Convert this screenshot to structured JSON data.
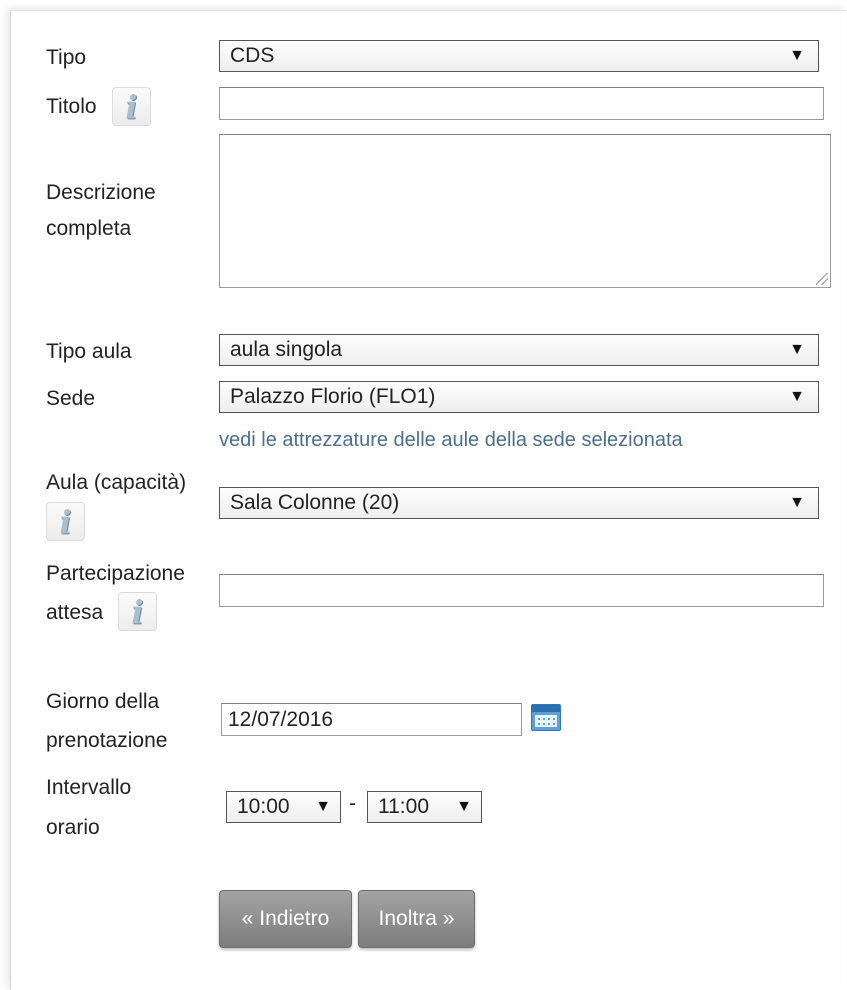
{
  "form": {
    "tipo": {
      "label": "Tipo",
      "value": "CDS"
    },
    "titolo": {
      "label": "Titolo",
      "value": ""
    },
    "descrizione": {
      "label_line1": "Descrizione",
      "label_line2": "completa",
      "value": ""
    },
    "tipo_aula": {
      "label": "Tipo aula",
      "value": "aula singola"
    },
    "sede": {
      "label": "Sede",
      "value": "Palazzo Florio (FLO1)",
      "link": "vedi le attrezzature delle aule della sede selezionata"
    },
    "aula": {
      "label": "Aula (capacità)",
      "value": "Sala Colonne (20)"
    },
    "partecipazione": {
      "label_line1": "Partecipazione",
      "label_line2": "attesa",
      "value": ""
    },
    "giorno": {
      "label_line1": "Giorno della",
      "label_line2": "prenotazione",
      "value": "12/07/2016"
    },
    "intervallo": {
      "label_line1": "Intervallo",
      "label_line2": "orario",
      "from": "10:00",
      "separator": "-",
      "to": "11:00"
    }
  },
  "icons": {
    "info": "i",
    "dropdown_arrow": "▼"
  },
  "buttons": {
    "back": "« Indietro",
    "forward": "Inoltra »"
  }
}
